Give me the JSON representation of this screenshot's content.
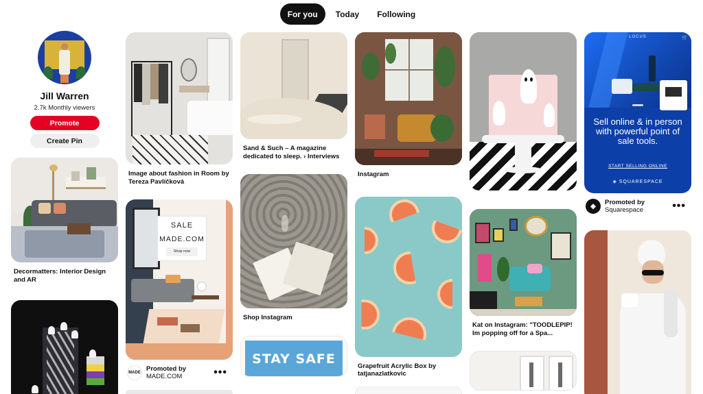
{
  "tabs": [
    "For you",
    "Today",
    "Following"
  ],
  "profile": {
    "name": "Jill Warren",
    "viewers": "2.7k Monthly viewers",
    "promote_label": "Promote",
    "create_pin_label": "Create Pin"
  },
  "pins": {
    "c1_decor": "Decormatters: Interior Design and AR",
    "c2_fashion": "Image about fashion in Room by Tereza Pavlíčková",
    "c2_made_ad": {
      "sale": "SALE",
      "brand": "MADE.COM",
      "shop": "Shop now"
    },
    "c2_made_promo": {
      "line1": "Promoted by",
      "line2": "MADE.COM",
      "logo": "MADE"
    },
    "c3_sand": "Sand & Such – A magazine dedicated to sleep. › Interviews",
    "c3_shop": "Shop Instagram",
    "c3_stay": "STAY SAFE",
    "c4_instagram": "Instagram",
    "c4_grapefruit": "Grapefruit Acrylic Box by tatjanazlatkovic",
    "c5_kat": "Kat on Instagram: \"TOODLEPIP! Im popping off for a Spa...",
    "c6_sq_ad": {
      "brand_top": "LOCUS",
      "headline": "Sell online & in person with powerful point of sale tools.",
      "cta": "START SELLING ONLINE",
      "logo": "SQUARESPACE"
    },
    "c6_sq_promo": {
      "line1": "Promoted by",
      "line2": "Squarespace"
    }
  }
}
